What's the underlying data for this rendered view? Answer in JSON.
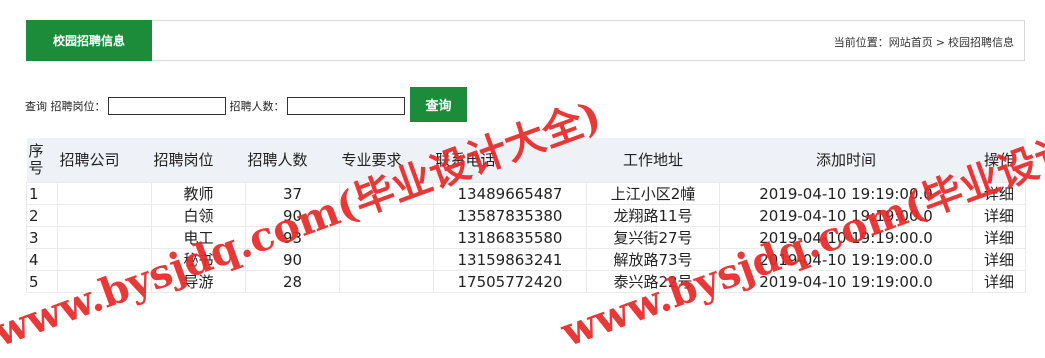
{
  "header": {
    "tab_title": "校园招聘信息",
    "breadcrumb": {
      "prefix": "当前位置：",
      "home": "网站首页",
      "separator": ">",
      "current": "校园招聘信息"
    }
  },
  "search": {
    "query_label": "查询",
    "position_label": "招聘岗位：",
    "position_value": "",
    "count_label": "招聘人数：",
    "count_value": "",
    "button_label": "查询"
  },
  "table": {
    "columns": [
      "序号",
      "招聘公司",
      "招聘岗位",
      "招聘人数",
      "专业要求",
      "联系电话",
      "工作地址",
      "添加时间",
      "操作"
    ],
    "rows": [
      {
        "no": "1",
        "company": "",
        "position": "教师",
        "count": "37",
        "major": "",
        "phone": "13489665487",
        "address": "上江小区2幢",
        "time": "2019-04-10 19:19:00.0",
        "action": "详细"
      },
      {
        "no": "2",
        "company": "",
        "position": "白领",
        "count": "90",
        "major": "",
        "phone": "13587835380",
        "address": "龙翔路11号",
        "time": "2019-04-10 19:19:00.0",
        "action": "详细"
      },
      {
        "no": "3",
        "company": "",
        "position": "电工",
        "count": "93",
        "major": "",
        "phone": "13186835580",
        "address": "复兴街27号",
        "time": "2019-04-10 19:19:00.0",
        "action": "详细"
      },
      {
        "no": "4",
        "company": "",
        "position": "秘书",
        "count": "90",
        "major": "",
        "phone": "13159863241",
        "address": "解放路73号",
        "time": "2019-04-10 19:19:00.0",
        "action": "详细"
      },
      {
        "no": "5",
        "company": "",
        "position": "导游",
        "count": "28",
        "major": "",
        "phone": "17505772420",
        "address": "泰兴路22号",
        "time": "2019-04-10 19:19:00.0",
        "action": "详细"
      }
    ]
  },
  "watermark": {
    "text_left": "www.bysjdq.com(毕业设计大全)",
    "text_right": "www.bysjdq.com(毕业设计大全)",
    "color": "#e62828"
  },
  "colors": {
    "accent": "#1c8c3b",
    "table_header_bg": "#eef1f5"
  }
}
